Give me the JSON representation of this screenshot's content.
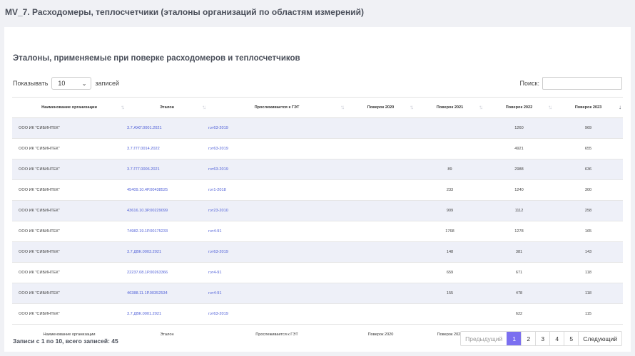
{
  "page_title": "MV_7. Расходомеры, теплосчетчики (эталоны организаций по областям измерений)",
  "card_title": "Эталоны, применяемые при поверке расходомеров и теплосчетчиков",
  "length": {
    "prefix": "Показывать",
    "value": "10",
    "suffix": "записей"
  },
  "search": {
    "label": "Поиск:",
    "value": ""
  },
  "columns": [
    "Наименование организации",
    "Эталон",
    "Прослеживается к ГЭТ",
    "Поверок 2020",
    "Поверок 2021",
    "Поверок 2022",
    "Поверок 2023"
  ],
  "rows": [
    {
      "org": "ООО ИК \"СИБИНТЕК\"",
      "etalon": "3.7.АЖГ.0001.2021",
      "get": "гэт63-2019",
      "p2020": "",
      "p2021": "",
      "p2022": "1260",
      "p2023": "969"
    },
    {
      "org": "ООО ИК \"СИБИНТЕК\"",
      "etalon": "3.7.ГГГ.0014.2022",
      "get": "гэт63-2019",
      "p2020": "",
      "p2021": "",
      "p2022": "4921",
      "p2023": "655"
    },
    {
      "org": "ООО ИК \"СИБИНТЕК\"",
      "etalon": "3.7.ГГГ.0006.2021",
      "get": "гэт63-2019",
      "p2020": "",
      "p2021": "89",
      "p2022": "2988",
      "p2023": "636"
    },
    {
      "org": "ООО ИК \"СИБИНТЕК\"",
      "etalon": "45409.10.4Р.00438525",
      "get": "гэт1-2018",
      "p2020": "",
      "p2021": "233",
      "p2022": "1240",
      "p2023": "300"
    },
    {
      "org": "ООО ИК \"СИБИНТЕК\"",
      "etalon": "43616.10.3Р.00229099",
      "get": "гэт23-2010",
      "p2020": "",
      "p2021": "909",
      "p2022": "1112",
      "p2023": "258"
    },
    {
      "org": "ООО ИК \"СИБИНТЕК\"",
      "etalon": "74982.19.1Р.00175233",
      "get": "гэт4-91",
      "p2020": "",
      "p2021": "1768",
      "p2022": "1278",
      "p2023": "165"
    },
    {
      "org": "ООО ИК \"СИБИНТЕК\"",
      "etalon": "3.7.ДВК.0003.2021",
      "get": "гэт63-2019",
      "p2020": "",
      "p2021": "148",
      "p2022": "381",
      "p2023": "143"
    },
    {
      "org": "ООО ИК \"СИБИНТЕК\"",
      "etalon": "22237.08.1Р.00263366",
      "get": "гэт4-91",
      "p2020": "",
      "p2021": "659",
      "p2022": "671",
      "p2023": "118"
    },
    {
      "org": "ООО ИК \"СИБИНТЕК\"",
      "etalon": "46388.11.1Р.00352534",
      "get": "гэт4-91",
      "p2020": "",
      "p2021": "155",
      "p2022": "478",
      "p2023": "118"
    },
    {
      "org": "ООО ИК \"СИБИНТЕК\"",
      "etalon": "3.7.ДВК.0001.2021",
      "get": "гэт63-2019",
      "p2020": "",
      "p2021": "",
      "p2022": "622",
      "p2023": "115"
    }
  ],
  "info": "Записи с 1 по 10, всего записей: 45",
  "pagination": {
    "prev": "Предыдущий",
    "pages": [
      "1",
      "2",
      "3",
      "4",
      "5"
    ],
    "current": "1",
    "next": "Следующий"
  }
}
